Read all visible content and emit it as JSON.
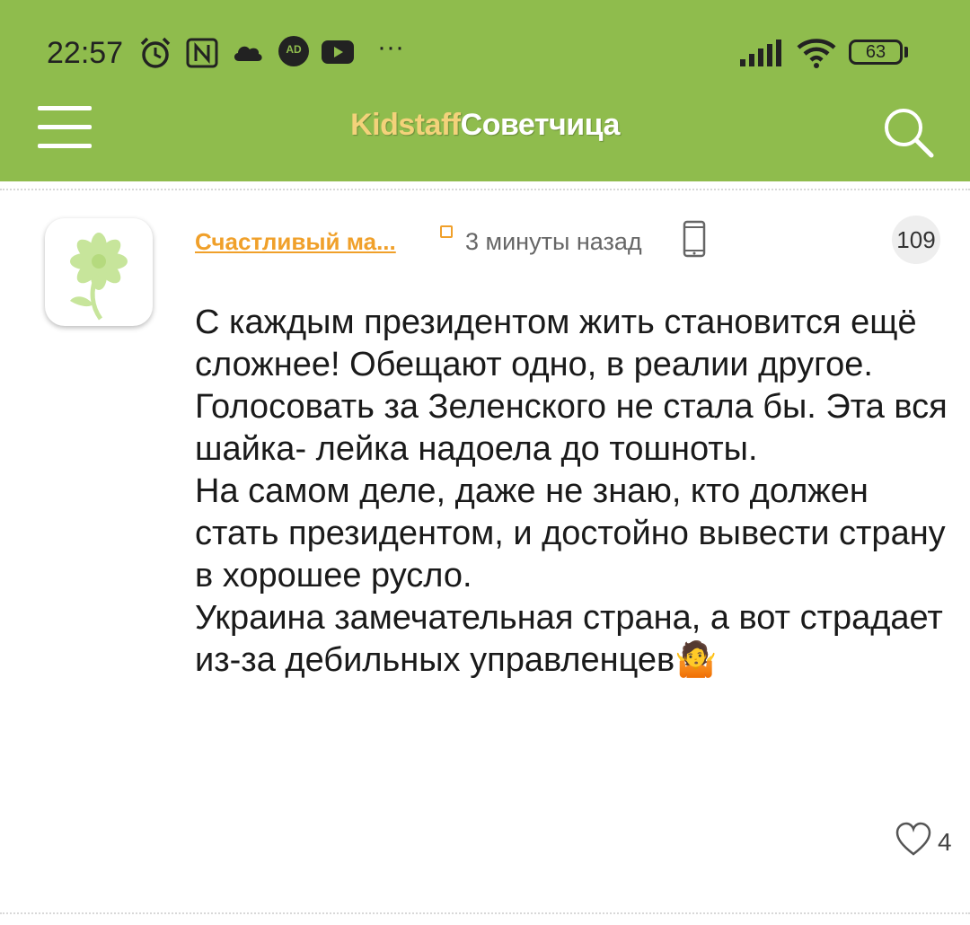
{
  "status_bar": {
    "time": "22:57",
    "battery": "63",
    "ad_badge": "AD",
    "more": "···"
  },
  "header": {
    "brand": "Kidstaff",
    "section": "Советчица",
    "menu_icon": "hamburger-icon",
    "search_icon": "search-icon",
    "background_color": "#8fbc4d"
  },
  "comment": {
    "author": "Счастливый ма...",
    "time_ago": "3 минуты назад",
    "post_number": "109",
    "text": "С каждым президентом жить становится ещё сложнее! Обещают одно, в реалии другое.\nГолосовать за Зеленского не стала бы. Эта вся шайка- лейка надоела до тошноты.\nНа самом деле, даже не знаю, кто должен стать президентом, и достойно вывести страну в хорошее русло.\nУкраина замечательная страна, а вот страдает из-за дебильных управленцев🤷",
    "likes": "4",
    "accent_color": "#f0a02a"
  }
}
